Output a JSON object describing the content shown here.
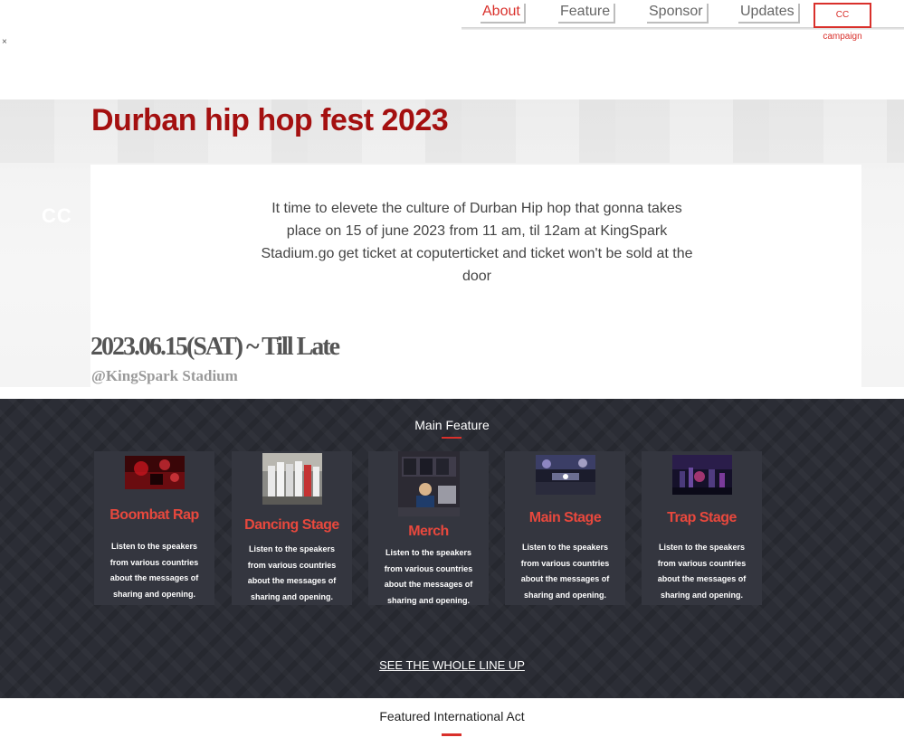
{
  "nav": {
    "items": [
      {
        "label": "About",
        "active": true
      },
      {
        "label": "Feature",
        "active": false
      },
      {
        "label": "Sponsor",
        "active": false
      },
      {
        "label": "Updates",
        "active": false
      }
    ],
    "cc_button": "CC campaign",
    "close_glyph": "×"
  },
  "hero": {
    "side_mark": "CC",
    "title": "Durban hip hop fest 2023",
    "description": "It time to elevete the culture of Durban Hip hop that gonna takes place on 15 of june 2023 from 11 am, til 12am at KingSpark Stadium.go get ticket at coputerticket and ticket won't be sold at the door",
    "date": "2023.06.15(SAT) ~ Till Late",
    "venue": "@KingSpark Stadium"
  },
  "features": {
    "title": "Main Feature",
    "cards": [
      {
        "name": "Boombat Rap",
        "blurb": "Listen to the speakers from various countries about the messages of sharing and opening."
      },
      {
        "name": "Dancing Stage",
        "blurb": "Listen to the speakers from various countries about the messages of sharing and opening."
      },
      {
        "name": "Merch",
        "blurb": "Listen to the speakers from various countries about the messages of sharing and opening."
      },
      {
        "name": "Main Stage",
        "blurb": "Listen to the speakers from various countries about the messages of sharing and opening."
      },
      {
        "name": "Trap Stage",
        "blurb": "Listen to the speakers from various countries about the messages of sharing and opening."
      }
    ],
    "lineup_link": "SEE THE WHOLE LINE UP"
  },
  "international": {
    "title": "Featured International Act"
  },
  "colors": {
    "accent": "#d9302b",
    "title_red": "#a41010",
    "dark_bg": "#2b2d35",
    "card_bg": "#34363f"
  }
}
